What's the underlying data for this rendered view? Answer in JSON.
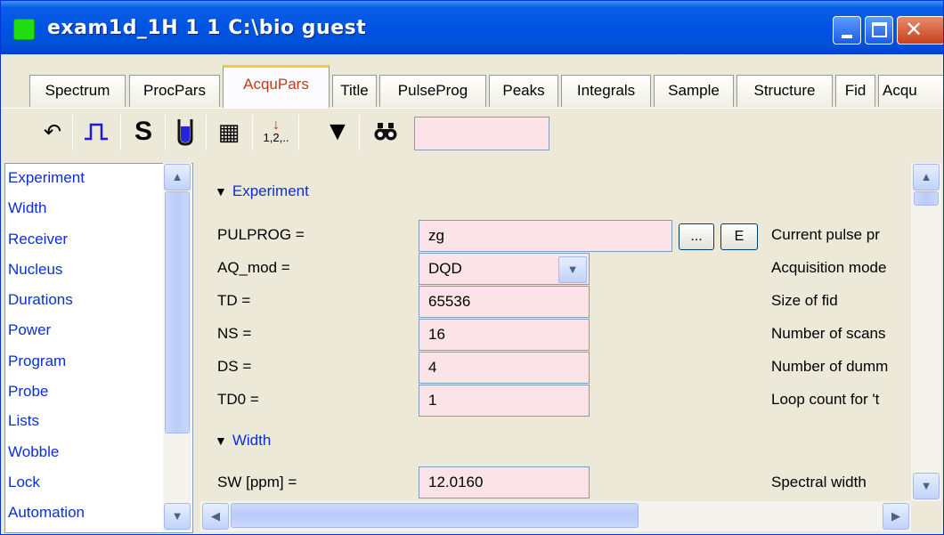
{
  "window": {
    "title": "exam1d_1H  1  1  C:\\bio  guest",
    "close_glyph": "✕"
  },
  "tabs": [
    "Spectrum",
    "ProcPars",
    "AcquPars",
    "Title",
    "PulseProg",
    "Peaks",
    "Integrals",
    "Sample",
    "Structure",
    "Fid",
    "Acqu"
  ],
  "active_tab": "AcquPars",
  "toolbar": {
    "undo_icon": "↶",
    "pulse_icon": "⎍",
    "s_label": "S",
    "probe_icon": "tube-icon",
    "table_icon": "▦",
    "sort_icon": "1,2,..",
    "filter_icon": "▼",
    "find_icon": "binoculars-icon",
    "search_value": ""
  },
  "sidebar": {
    "items": [
      "Experiment",
      "Width",
      "Receiver",
      "Nucleus",
      "Durations",
      "Power",
      "Program",
      "Probe",
      "Lists",
      "Wobble",
      "Lock",
      "Automation"
    ]
  },
  "sections": {
    "experiment": "Experiment",
    "width": "Width"
  },
  "params": [
    {
      "label": "PULPROG =",
      "value": "zg",
      "desc": "Current pulse pr"
    },
    {
      "label": "AQ_mod =",
      "value": "DQD",
      "desc": "Acquisition mode"
    },
    {
      "label": "TD =",
      "value": "65536",
      "desc": "Size of fid"
    },
    {
      "label": "NS =",
      "value": "16",
      "desc": "Number of scans"
    },
    {
      "label": "DS =",
      "value": "4",
      "desc": "Number of dumm"
    },
    {
      "label": "TD0 =",
      "value": "1",
      "desc": "Loop count for 't"
    },
    {
      "label": "SW [ppm] =",
      "value": "12.0160",
      "desc": "Spectral width"
    }
  ],
  "buttons": {
    "browse": "...",
    "edit": "E"
  },
  "scroll": {
    "up": "▲",
    "down": "▼",
    "left": "◀",
    "right": "▶",
    "dropdown": "▼"
  }
}
